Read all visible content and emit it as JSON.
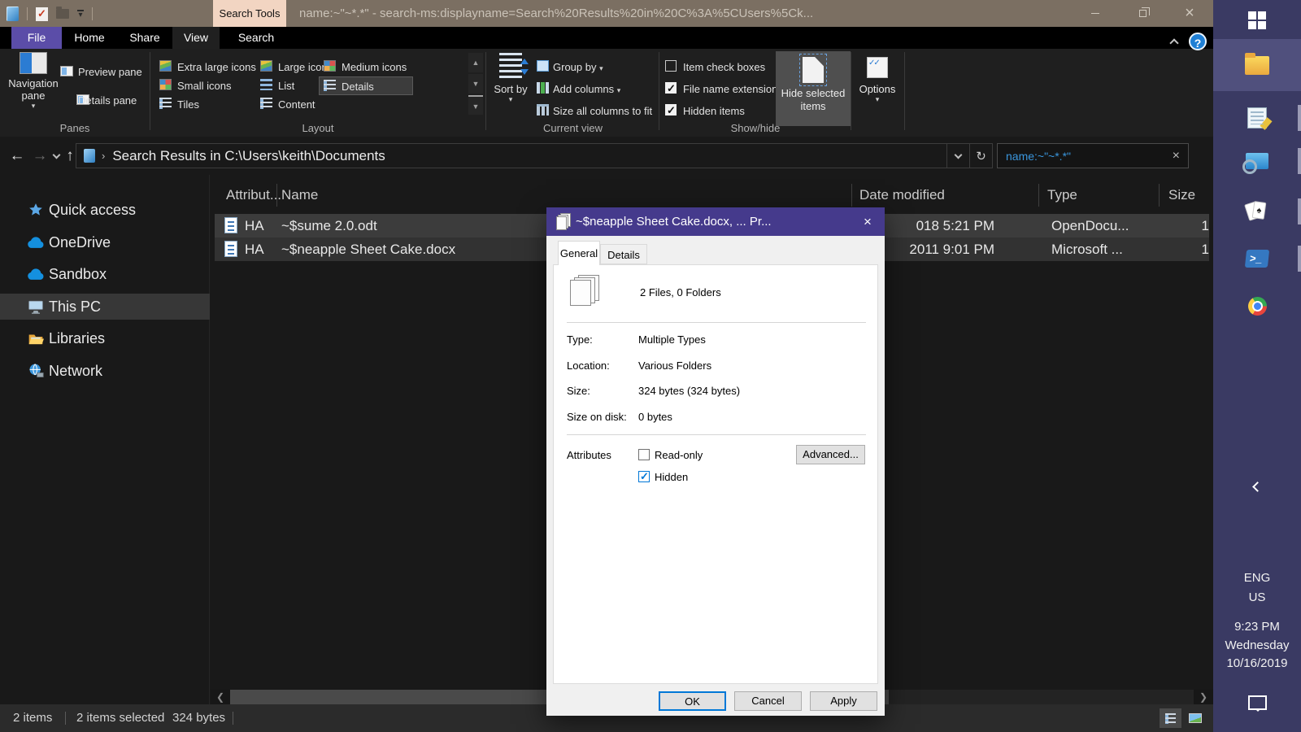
{
  "titlebar": {
    "title": "name:~\"~*.*\" - search-ms:displayname=Search%20Results%20in%20C%3A%5CUsers%5Ck...",
    "contextual_tab": "Search Tools"
  },
  "menu_tabs": [
    "File",
    "Home",
    "Share",
    "View",
    "Search"
  ],
  "ribbon": {
    "panes": {
      "group_label": "Panes",
      "navigation_pane": "Navigation pane",
      "preview_pane": "Preview pane",
      "details_pane": "Details pane"
    },
    "layout": {
      "group_label": "Layout",
      "extra_large_icons": "Extra large icons",
      "large_icons": "Large icons",
      "medium_icons": "Medium icons",
      "small_icons": "Small icons",
      "list": "List",
      "details": "Details",
      "tiles": "Tiles",
      "content": "Content"
    },
    "current_view": {
      "group_label": "Current view",
      "sort_by": "Sort by",
      "group_by": "Group by",
      "add_columns": "Add columns",
      "size_all_columns": "Size all columns to fit"
    },
    "show_hide": {
      "group_label": "Show/hide",
      "item_check_boxes": "Item check boxes",
      "file_name_extensions": "File name extensions",
      "hidden_items": "Hidden items",
      "hide_selected_items": "Hide selected items"
    },
    "options": "Options"
  },
  "address_bar": {
    "path": "Search Results in C:\\Users\\keith\\Documents",
    "search_value": "name:~\"~*.*\""
  },
  "sidebar": {
    "items": [
      {
        "label": "Quick access"
      },
      {
        "label": "OneDrive"
      },
      {
        "label": "Sandbox"
      },
      {
        "label": "This PC"
      },
      {
        "label": "Libraries"
      },
      {
        "label": "Network"
      }
    ]
  },
  "file_list": {
    "columns": {
      "attributes": "Attribut...",
      "name": "Name",
      "date_modified": "Date modified",
      "type": "Type",
      "size": "Size"
    },
    "rows": [
      {
        "attributes": "HA",
        "name": "~$sume 2.0.odt",
        "date_modified": "018 5:21 PM",
        "type": "OpenDocu...",
        "size": "1"
      },
      {
        "attributes": "HA",
        "name": "~$neapple Sheet Cake.docx",
        "date_modified": "2011 9:01 PM",
        "type": "Microsoft ...",
        "size": "1"
      }
    ]
  },
  "status_bar": {
    "item_count": "2 items",
    "selection": "2 items selected",
    "selection_size": "324 bytes"
  },
  "dialog": {
    "title": "~$neapple Sheet Cake.docx, ... Pr...",
    "tab_general": "General",
    "tab_details": "Details",
    "summary": "2 Files, 0 Folders",
    "fields": [
      {
        "label": "Type:",
        "value": "Multiple Types"
      },
      {
        "label": "Location:",
        "value": "Various Folders"
      },
      {
        "label": "Size:",
        "value": "324 bytes (324 bytes)"
      },
      {
        "label": "Size on disk:",
        "value": "0 bytes"
      }
    ],
    "attributes_label": "Attributes",
    "read_only_label": "Read-only",
    "hidden_label": "Hidden",
    "advanced_button": "Advanced...",
    "ok_button": "OK",
    "cancel_button": "Cancel",
    "apply_button": "Apply"
  },
  "taskbar": {
    "language": "ENG",
    "region": "US",
    "time": "9:23 PM",
    "weekday": "Wednesday",
    "date": "10/16/2019"
  },
  "icons": {
    "back": "←",
    "forward": "→",
    "up": "↑",
    "refresh": "↻",
    "dropdown": "▾",
    "breadcrumb": "›",
    "clear": "×",
    "close": "×",
    "gallery_up": "▲",
    "gallery_down": "▼",
    "gallery_more": "▼",
    "help": "?",
    "prompt": ">_",
    "spade": "♠",
    "scroll_left": "❮",
    "scroll_right": "❯"
  },
  "colors": {
    "dialog_accent": "#453a8c",
    "search_text": "#3a96dd",
    "contextual_tab_bg": "#f2d5c2",
    "file_tab_bg": "#5b4da8",
    "taskbar_bg": "#3a3a63"
  }
}
